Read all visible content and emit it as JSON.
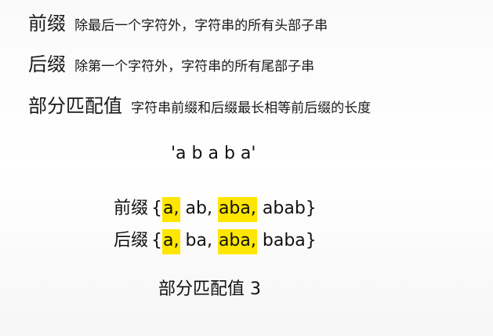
{
  "definitions": [
    {
      "term": "前缀",
      "desc": "除最后一个字符外，字符串的所有头部子串"
    },
    {
      "term": "后缀",
      "desc": "除第一个字符外，字符串的所有尾部子串"
    },
    {
      "term": "部分匹配值",
      "desc": "字符串前缀和后缀最长相等前后缀的长度"
    }
  ],
  "example": {
    "string": "'a b a b a'",
    "prefix_label": "前缀",
    "prefix_items": [
      "a",
      "ab",
      "aba",
      "abab"
    ],
    "suffix_label": "后缀",
    "suffix_items": [
      "a",
      "ba",
      "aba",
      "baba"
    ],
    "highlight_color": "#ffe600",
    "result_label": "部分匹配值",
    "result_value": "3"
  }
}
